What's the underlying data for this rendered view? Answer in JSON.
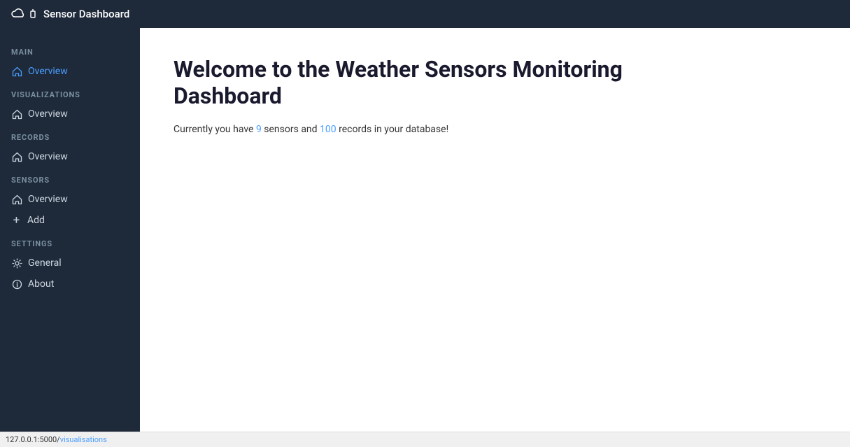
{
  "navbar": {
    "title": "Sensor Dashboard",
    "icons": [
      "cloud-icon",
      "sensor-icon"
    ]
  },
  "sidebar": {
    "sections": [
      {
        "label": "MAIN",
        "items": [
          {
            "id": "main-overview",
            "text": "Overview",
            "icon": "home-icon",
            "active": true
          }
        ]
      },
      {
        "label": "VISUALIZATIONS",
        "items": [
          {
            "id": "viz-overview",
            "text": "Overview",
            "icon": "home-icon",
            "active": false
          }
        ]
      },
      {
        "label": "RECORDS",
        "items": [
          {
            "id": "records-overview",
            "text": "Overview",
            "icon": "home-icon",
            "active": false
          }
        ]
      },
      {
        "label": "SENSORS",
        "items": [
          {
            "id": "sensors-overview",
            "text": "Overview",
            "icon": "home-icon",
            "active": false
          },
          {
            "id": "sensors-add",
            "text": "Add",
            "icon": "plus-icon",
            "active": false
          }
        ]
      },
      {
        "label": "SETTINGS",
        "items": [
          {
            "id": "settings-general",
            "text": "General",
            "icon": "gear-icon",
            "active": false
          },
          {
            "id": "settings-about",
            "text": "About",
            "icon": "info-icon",
            "active": false
          }
        ]
      }
    ]
  },
  "main": {
    "title_line1": "Welcome to the Weather Sensors Monitoring",
    "title_line2": "Dashboard",
    "subtitle_prefix": "Currently you have ",
    "sensor_count": "9",
    "subtitle_middle": " sensors and ",
    "record_count": "100",
    "subtitle_suffix": " records in your database!"
  },
  "statusbar": {
    "url_base": "127.0.0.1:5000/",
    "url_path": "visualisations"
  }
}
